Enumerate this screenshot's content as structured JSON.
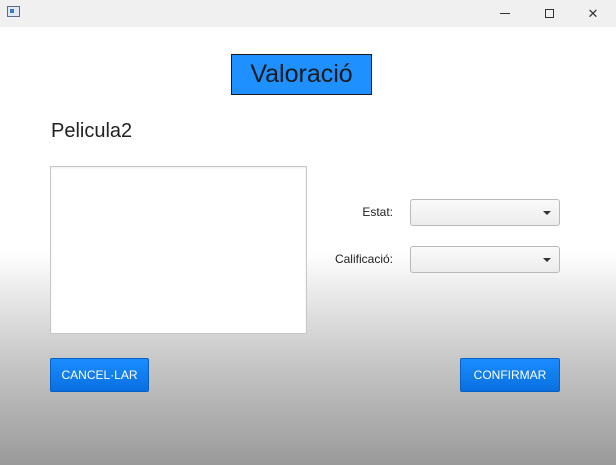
{
  "window": {
    "controls": {
      "minimize": "minimize",
      "maximize": "maximize",
      "close": "✕"
    }
  },
  "header": {
    "title": "Valoració"
  },
  "movie": {
    "name": "Pelicula2"
  },
  "form": {
    "comment": "",
    "estat": {
      "label": "Estat:",
      "value": ""
    },
    "calificacio": {
      "label": "Calificació:",
      "value": ""
    }
  },
  "actions": {
    "cancel_label": "CANCEL·LAR",
    "confirm_label": "CONFIRMAR"
  },
  "colors": {
    "accent": "#1e90ff",
    "button": "#0a7cf0"
  }
}
